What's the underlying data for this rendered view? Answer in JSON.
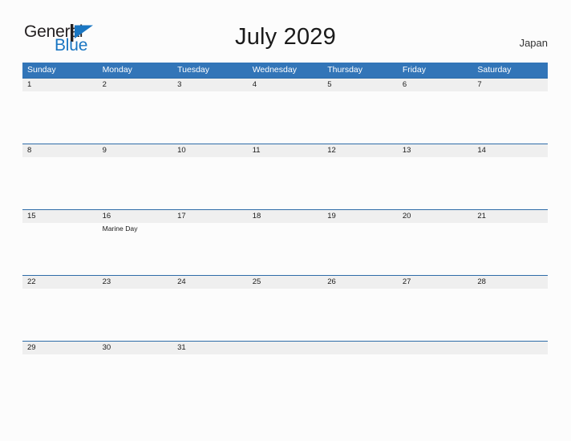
{
  "header": {
    "logo": {
      "text_primary": "General",
      "text_secondary": "Blue",
      "mark_icon": "flag-triangle-icon",
      "color_primary": "#231f20",
      "color_secondary": "#1a76c2"
    },
    "title": "July 2029",
    "country": "Japan"
  },
  "calendar": {
    "accent_color": "#3275b8",
    "band_color": "#efefef",
    "weekday_headers": [
      "Sunday",
      "Monday",
      "Tuesday",
      "Wednesday",
      "Thursday",
      "Friday",
      "Saturday"
    ],
    "weeks": [
      {
        "dates": [
          "1",
          "2",
          "3",
          "4",
          "5",
          "6",
          "7"
        ],
        "events": [
          "",
          "",
          "",
          "",
          "",
          "",
          ""
        ]
      },
      {
        "dates": [
          "8",
          "9",
          "10",
          "11",
          "12",
          "13",
          "14"
        ],
        "events": [
          "",
          "",
          "",
          "",
          "",
          "",
          ""
        ]
      },
      {
        "dates": [
          "15",
          "16",
          "17",
          "18",
          "19",
          "20",
          "21"
        ],
        "events": [
          "",
          "Marine Day",
          "",
          "",
          "",
          "",
          ""
        ]
      },
      {
        "dates": [
          "22",
          "23",
          "24",
          "25",
          "26",
          "27",
          "28"
        ],
        "events": [
          "",
          "",
          "",
          "",
          "",
          "",
          ""
        ]
      },
      {
        "dates": [
          "29",
          "30",
          "31",
          "",
          "",
          "",
          ""
        ],
        "events": [
          "",
          "",
          "",
          "",
          "",
          "",
          ""
        ]
      }
    ]
  }
}
